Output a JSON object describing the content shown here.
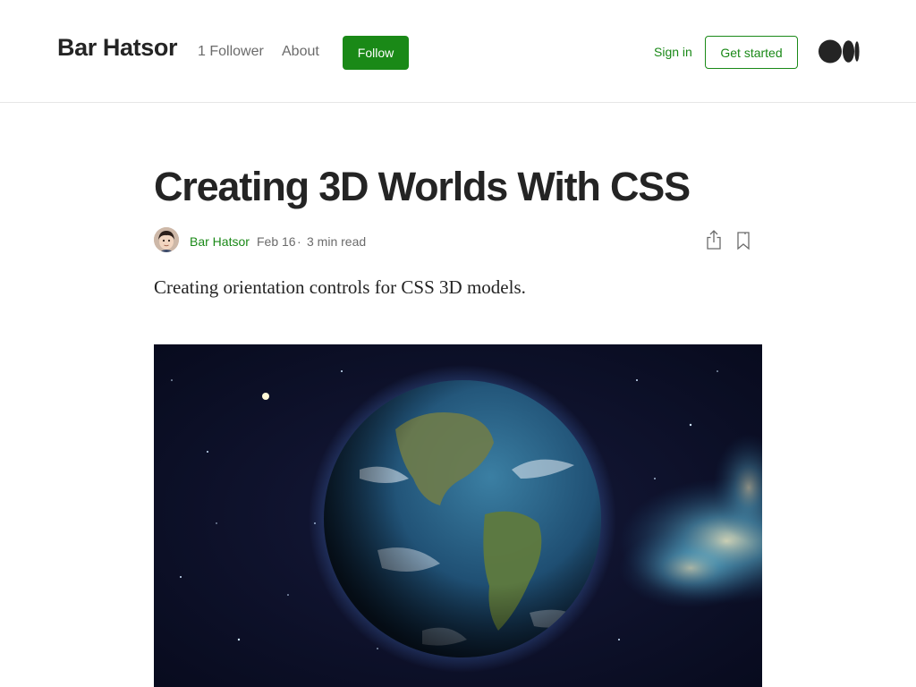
{
  "header": {
    "brand": "Bar Hatsor",
    "followers": "1 Follower",
    "about": "About",
    "follow_label": "Follow",
    "sign_in": "Sign in",
    "get_started": "Get started",
    "logo_icon": "medium-logo-icon"
  },
  "article": {
    "title": "Creating 3D Worlds With CSS",
    "author": "Bar Hatsor",
    "date": "Feb 16",
    "separator": "·",
    "read_time": "3 min read",
    "subtitle": "Creating orientation controls for CSS 3D models.",
    "icons": [
      "share-icon",
      "bookmark-icon"
    ]
  },
  "colors": {
    "accent": "#1a8917",
    "text": "#242424",
    "muted": "#6b6b6b",
    "divider": "#e6e6e6"
  }
}
